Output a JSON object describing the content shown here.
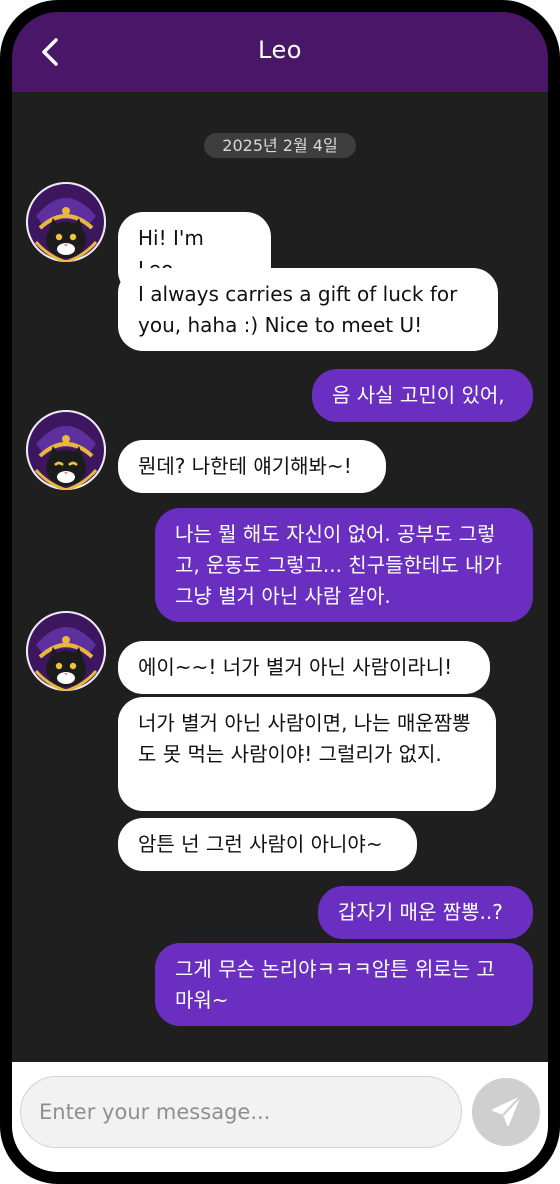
{
  "header": {
    "title": "Leo"
  },
  "date_label": "2025년 2월 4일",
  "messages": [
    "Hi! I'm Leo.",
    "I always carries a gift of luck for you, haha :) Nice to meet U!",
    "음 사실 고민이 있어,",
    "뭔데? 나한테 얘기해봐~!",
    "나는 뭘 해도 자신이 없어. 공부도 그렇고, 운동도 그렇고... 친구들한테도 내가 그냥 별거 아닌 사람 같아.",
    "에이~~! 너가 별거 아닌 사람이라니!",
    "너가 별거 아닌 사람이면, 나는 매운짬뽕도 못 먹는 사람이야! 그럴리가 없지.",
    "암튼 넌 그런 사람이 아니야~",
    "갑자기 매운 짬뽕..?",
    "그게 무슨 논리야ㅋㅋㅋ암튼 위로는 고마워~"
  ],
  "composer": {
    "placeholder": "Enter your message..."
  },
  "colors": {
    "header": "#4a1668",
    "outgoing": "#6a2fc0",
    "incoming": "#ffffff",
    "background": "#1f1f1f"
  },
  "icons": {
    "back": "chevron-left-icon",
    "send": "paper-plane-icon",
    "avatar": "black-cat-avatar"
  }
}
